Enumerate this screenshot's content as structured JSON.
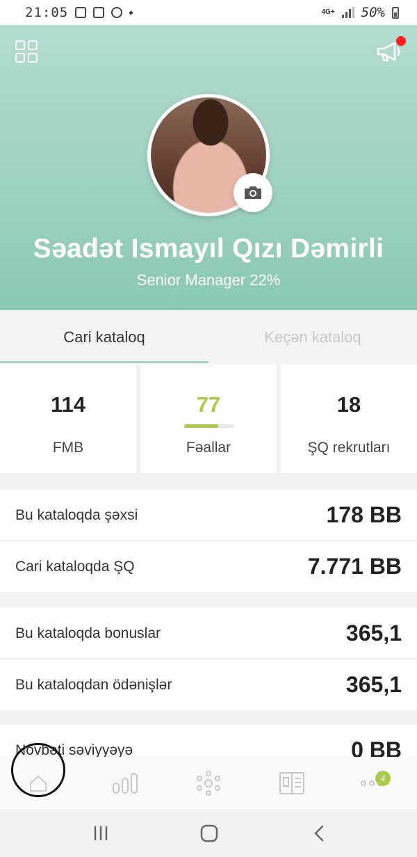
{
  "status_bar": {
    "time": "21:05",
    "network": "4G+",
    "battery": "50%"
  },
  "profile": {
    "name": "Səadət Ismayıl Qızı Dəmirli",
    "rank": "Senior Manager 22%"
  },
  "tabs": [
    {
      "label": "Cari kataloq",
      "active": true
    },
    {
      "label": "Keçən kataloq",
      "active": false
    }
  ],
  "stats": [
    {
      "value": "114",
      "label": "FMB"
    },
    {
      "value": "77",
      "label": "Fəallar",
      "progress": 0.68,
      "color": "#a9c84c"
    },
    {
      "value": "18",
      "label": "ŞQ rekrutları"
    }
  ],
  "rows": [
    {
      "label": "Bu kataloqda şəxsi",
      "value": "178 BB"
    },
    {
      "label": "Cari kataloqda ŞQ",
      "value": "7.771 BB"
    },
    {
      "label": "Bu kataloqda bonuslar",
      "value": "365,1"
    },
    {
      "label": "Bu kataloqdan ödənişlər",
      "value": "365,1"
    },
    {
      "label": "Növbəti səviyyəyə",
      "value": "0 BB"
    }
  ],
  "bottom_nav": {
    "badge": "4",
    "items": [
      "home-icon",
      "bar-chart-icon",
      "network-icon",
      "catalog-icon",
      "more-icon"
    ]
  },
  "colors": {
    "header": "#9fd2c1",
    "accent": "#a9c84c",
    "notification": "#ff1f1f"
  }
}
